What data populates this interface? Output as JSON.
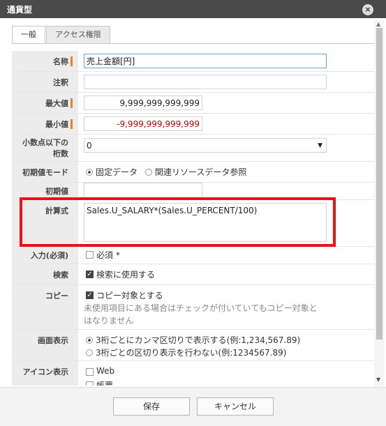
{
  "window": {
    "title": "通貨型",
    "close_icon": "×"
  },
  "tabs": [
    {
      "label": "一般"
    },
    {
      "label": "アクセス権限"
    }
  ],
  "fields": {
    "name": {
      "label": "名称",
      "value": "売上金額[円]"
    },
    "note": {
      "label": "注釈",
      "value": ""
    },
    "max": {
      "label": "最大値",
      "value": "9,999,999,999,999"
    },
    "min": {
      "label": "最小値",
      "value": "-9,999,999,999,999"
    },
    "decimals": {
      "label": "小数点以下の桁数",
      "label_line1": "小数点以下の",
      "label_line2": "桁数",
      "value": "0",
      "arrow": "▼"
    },
    "init_mode": {
      "label": "初期値モード",
      "opt1": "固定データ",
      "opt2": "関連リソースデータ参照"
    },
    "init_value": {
      "label": "初期値",
      "value": ""
    },
    "formula": {
      "label": "計算式",
      "value": "Sales.U_SALARY*(Sales.U_PERCENT/100)"
    },
    "required": {
      "label": "入力(必須)",
      "option": "必須 *"
    },
    "search": {
      "label": "検索",
      "option": "検索に使用する"
    },
    "copy": {
      "label": "コピー",
      "option": "コピー対象とする",
      "note": "未使用項目にある場合はチェックが付いていてもコピー対象とはなりません"
    },
    "display": {
      "label": "画面表示",
      "opt1": "3桁ごとにカンマ区切りで表示する(例:1,234,567.89)",
      "opt2": "3桁ごとの区切り表示を行わない(例:1234567.89)"
    },
    "icon": {
      "label": "アイコン表示",
      "opt1": "Web",
      "opt2": "帳票"
    }
  },
  "footer": {
    "save": "保存",
    "cancel": "キャンセル"
  },
  "colors": {
    "accent": "#e8822a",
    "highlight": "#e61414",
    "negative": "#cc0000"
  }
}
